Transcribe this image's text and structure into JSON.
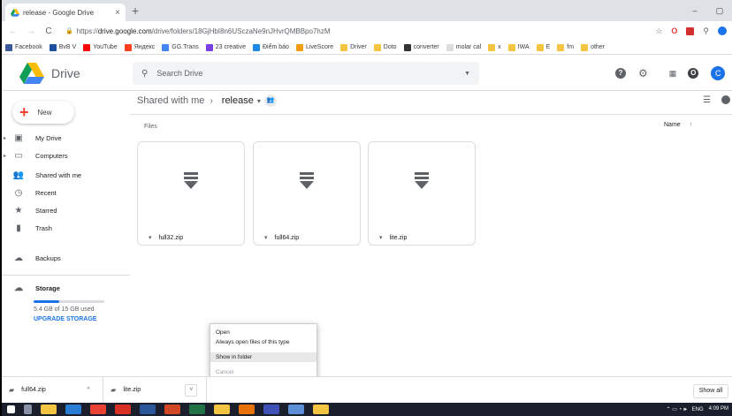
{
  "browser": {
    "tab_title": "release - Google Drive",
    "tab_close": "×",
    "new_tab": "+",
    "win_min": "–",
    "win_max": "▢",
    "url_prefix": "https://",
    "url_host": "drive.google.com",
    "url_path": "/drive/folders/18GjHbI8n6USczaNe9nJHvrQMBBpo7hzM",
    "back": "←",
    "forward": "→",
    "reload": "C",
    "lock": "🔒",
    "star": "☆"
  },
  "bookmarks": [
    {
      "label": "Facebook",
      "color": "#3b5998"
    },
    {
      "label": "BvB V",
      "color": "#1c4fa0"
    },
    {
      "label": "YouTube",
      "color": "#ff0000"
    },
    {
      "label": "Яндекс",
      "color": "#fc3f1d"
    },
    {
      "label": "GG.Trans",
      "color": "#4285f4"
    },
    {
      "label": "23 creative",
      "color": "#7b3fe4"
    },
    {
      "label": "Điểm báo",
      "color": "#1e88e5"
    },
    {
      "label": "LiveScore",
      "color": "#f39c12"
    },
    {
      "label": "Driver",
      "color": "#f4c542"
    },
    {
      "label": "Doto",
      "color": "#f4c542"
    },
    {
      "label": "converter",
      "color": "#333333"
    },
    {
      "label": "molar cal",
      "color": "#dddddd"
    },
    {
      "label": "x",
      "color": "#f4c542"
    },
    {
      "label": "IWA",
      "color": "#f4c542"
    },
    {
      "label": "E",
      "color": "#f4c542"
    },
    {
      "label": "fm",
      "color": "#f4c542"
    },
    {
      "label": "other",
      "color": "#f4c542"
    }
  ],
  "drive": {
    "name": "Drive",
    "search_placeholder": "Search Drive",
    "help": "?",
    "settings": "⚙",
    "apps": "⋮⋮⋮",
    "notif": "O",
    "avatar": "C"
  },
  "sidebar": {
    "new_label": "New",
    "items": [
      {
        "label": "My Drive",
        "icon": "drive-icon",
        "glyph": "▣",
        "arrow": "▸"
      },
      {
        "label": "Computers",
        "icon": "computer-icon",
        "glyph": "▭",
        "arrow": "▸"
      },
      {
        "label": "Shared with me",
        "icon": "people-icon",
        "glyph": "👥",
        "arrow": ""
      },
      {
        "label": "Recent",
        "icon": "clock-icon",
        "glyph": "◷",
        "arrow": ""
      },
      {
        "label": "Starred",
        "icon": "star-icon",
        "glyph": "★",
        "arrow": ""
      },
      {
        "label": "Trash",
        "icon": "trash-icon",
        "glyph": "▮",
        "arrow": ""
      },
      {
        "label": "Backups",
        "icon": "cloud-icon",
        "glyph": "☁",
        "arrow": ""
      },
      {
        "label": "Storage",
        "icon": "cloud-outline-icon",
        "glyph": "☁",
        "arrow": ""
      }
    ],
    "storage_text": "5.4 GB of 15 GB used",
    "storage_fraction": 0.36,
    "upgrade": "UPGRADE STORAGE"
  },
  "main": {
    "crumb_parent": "Shared with me",
    "crumb_sep": "›",
    "crumb_current": "release",
    "crumb_drop": "▾",
    "files_label": "Files",
    "sort_label": "Name",
    "sort_arrow": "↑",
    "files": [
      {
        "name": "full32.zip"
      },
      {
        "name": "full64.zip"
      },
      {
        "name": "lite.zip"
      }
    ]
  },
  "context_menu": {
    "items": [
      {
        "label": "Open",
        "state": "normal"
      },
      {
        "label": "Always open files of this type",
        "state": "normal"
      },
      {
        "label": "Show in folder",
        "state": "highlight"
      },
      {
        "label": "Cancel",
        "state": "disabled"
      }
    ]
  },
  "downloads": {
    "items": [
      {
        "name": "full64.zip",
        "chevron": "^"
      },
      {
        "name": "lite.zip",
        "chevron": "˅"
      }
    ],
    "show_all": "Show all"
  },
  "taskbar": {
    "lang": "ENG",
    "time": "4:09 PM",
    "tray_glyphs": "⌃ ▭ ◔ 🕪"
  }
}
